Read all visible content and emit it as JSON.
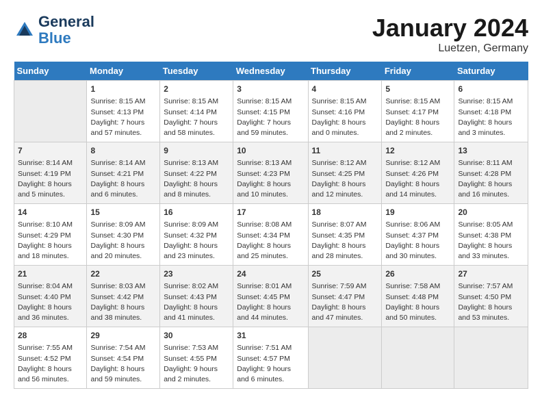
{
  "header": {
    "logo_line1": "General",
    "logo_line2": "Blue",
    "month": "January 2024",
    "location": "Luetzen, Germany"
  },
  "days_of_week": [
    "Sunday",
    "Monday",
    "Tuesday",
    "Wednesday",
    "Thursday",
    "Friday",
    "Saturday"
  ],
  "weeks": [
    [
      {
        "day": "",
        "empty": true
      },
      {
        "day": "1",
        "sunrise": "Sunrise: 8:15 AM",
        "sunset": "Sunset: 4:13 PM",
        "daylight": "Daylight: 7 hours and 57 minutes."
      },
      {
        "day": "2",
        "sunrise": "Sunrise: 8:15 AM",
        "sunset": "Sunset: 4:14 PM",
        "daylight": "Daylight: 7 hours and 58 minutes."
      },
      {
        "day": "3",
        "sunrise": "Sunrise: 8:15 AM",
        "sunset": "Sunset: 4:15 PM",
        "daylight": "Daylight: 7 hours and 59 minutes."
      },
      {
        "day": "4",
        "sunrise": "Sunrise: 8:15 AM",
        "sunset": "Sunset: 4:16 PM",
        "daylight": "Daylight: 8 hours and 0 minutes."
      },
      {
        "day": "5",
        "sunrise": "Sunrise: 8:15 AM",
        "sunset": "Sunset: 4:17 PM",
        "daylight": "Daylight: 8 hours and 2 minutes."
      },
      {
        "day": "6",
        "sunrise": "Sunrise: 8:15 AM",
        "sunset": "Sunset: 4:18 PM",
        "daylight": "Daylight: 8 hours and 3 minutes."
      }
    ],
    [
      {
        "day": "7",
        "sunrise": "Sunrise: 8:14 AM",
        "sunset": "Sunset: 4:19 PM",
        "daylight": "Daylight: 8 hours and 5 minutes."
      },
      {
        "day": "8",
        "sunrise": "Sunrise: 8:14 AM",
        "sunset": "Sunset: 4:21 PM",
        "daylight": "Daylight: 8 hours and 6 minutes."
      },
      {
        "day": "9",
        "sunrise": "Sunrise: 8:13 AM",
        "sunset": "Sunset: 4:22 PM",
        "daylight": "Daylight: 8 hours and 8 minutes."
      },
      {
        "day": "10",
        "sunrise": "Sunrise: 8:13 AM",
        "sunset": "Sunset: 4:23 PM",
        "daylight": "Daylight: 8 hours and 10 minutes."
      },
      {
        "day": "11",
        "sunrise": "Sunrise: 8:12 AM",
        "sunset": "Sunset: 4:25 PM",
        "daylight": "Daylight: 8 hours and 12 minutes."
      },
      {
        "day": "12",
        "sunrise": "Sunrise: 8:12 AM",
        "sunset": "Sunset: 4:26 PM",
        "daylight": "Daylight: 8 hours and 14 minutes."
      },
      {
        "day": "13",
        "sunrise": "Sunrise: 8:11 AM",
        "sunset": "Sunset: 4:28 PM",
        "daylight": "Daylight: 8 hours and 16 minutes."
      }
    ],
    [
      {
        "day": "14",
        "sunrise": "Sunrise: 8:10 AM",
        "sunset": "Sunset: 4:29 PM",
        "daylight": "Daylight: 8 hours and 18 minutes."
      },
      {
        "day": "15",
        "sunrise": "Sunrise: 8:09 AM",
        "sunset": "Sunset: 4:30 PM",
        "daylight": "Daylight: 8 hours and 20 minutes."
      },
      {
        "day": "16",
        "sunrise": "Sunrise: 8:09 AM",
        "sunset": "Sunset: 4:32 PM",
        "daylight": "Daylight: 8 hours and 23 minutes."
      },
      {
        "day": "17",
        "sunrise": "Sunrise: 8:08 AM",
        "sunset": "Sunset: 4:34 PM",
        "daylight": "Daylight: 8 hours and 25 minutes."
      },
      {
        "day": "18",
        "sunrise": "Sunrise: 8:07 AM",
        "sunset": "Sunset: 4:35 PM",
        "daylight": "Daylight: 8 hours and 28 minutes."
      },
      {
        "day": "19",
        "sunrise": "Sunrise: 8:06 AM",
        "sunset": "Sunset: 4:37 PM",
        "daylight": "Daylight: 8 hours and 30 minutes."
      },
      {
        "day": "20",
        "sunrise": "Sunrise: 8:05 AM",
        "sunset": "Sunset: 4:38 PM",
        "daylight": "Daylight: 8 hours and 33 minutes."
      }
    ],
    [
      {
        "day": "21",
        "sunrise": "Sunrise: 8:04 AM",
        "sunset": "Sunset: 4:40 PM",
        "daylight": "Daylight: 8 hours and 36 minutes."
      },
      {
        "day": "22",
        "sunrise": "Sunrise: 8:03 AM",
        "sunset": "Sunset: 4:42 PM",
        "daylight": "Daylight: 8 hours and 38 minutes."
      },
      {
        "day": "23",
        "sunrise": "Sunrise: 8:02 AM",
        "sunset": "Sunset: 4:43 PM",
        "daylight": "Daylight: 8 hours and 41 minutes."
      },
      {
        "day": "24",
        "sunrise": "Sunrise: 8:01 AM",
        "sunset": "Sunset: 4:45 PM",
        "daylight": "Daylight: 8 hours and 44 minutes."
      },
      {
        "day": "25",
        "sunrise": "Sunrise: 7:59 AM",
        "sunset": "Sunset: 4:47 PM",
        "daylight": "Daylight: 8 hours and 47 minutes."
      },
      {
        "day": "26",
        "sunrise": "Sunrise: 7:58 AM",
        "sunset": "Sunset: 4:48 PM",
        "daylight": "Daylight: 8 hours and 50 minutes."
      },
      {
        "day": "27",
        "sunrise": "Sunrise: 7:57 AM",
        "sunset": "Sunset: 4:50 PM",
        "daylight": "Daylight: 8 hours and 53 minutes."
      }
    ],
    [
      {
        "day": "28",
        "sunrise": "Sunrise: 7:55 AM",
        "sunset": "Sunset: 4:52 PM",
        "daylight": "Daylight: 8 hours and 56 minutes."
      },
      {
        "day": "29",
        "sunrise": "Sunrise: 7:54 AM",
        "sunset": "Sunset: 4:54 PM",
        "daylight": "Daylight: 8 hours and 59 minutes."
      },
      {
        "day": "30",
        "sunrise": "Sunrise: 7:53 AM",
        "sunset": "Sunset: 4:55 PM",
        "daylight": "Daylight: 9 hours and 2 minutes."
      },
      {
        "day": "31",
        "sunrise": "Sunrise: 7:51 AM",
        "sunset": "Sunset: 4:57 PM",
        "daylight": "Daylight: 9 hours and 6 minutes."
      },
      {
        "day": "",
        "empty": true
      },
      {
        "day": "",
        "empty": true
      },
      {
        "day": "",
        "empty": true
      }
    ]
  ]
}
